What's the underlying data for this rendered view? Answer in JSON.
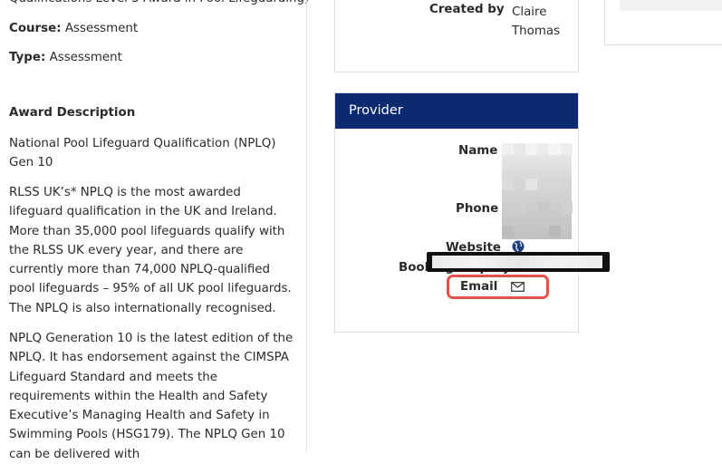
{
  "left": {
    "cut_title": "Qualifications Level 3 Award in Pool Lifeguarding)",
    "course_label": "Course:",
    "course_value": "Assessment",
    "type_label": "Type:",
    "type_value": "Assessment",
    "award_heading": "Award Description",
    "para1": "National Pool Lifeguard Qualification (NPLQ) Gen 10",
    "para2": "RLSS UK’s* NPLQ is the most awarded lifeguard qualification in the UK and Ireland. More than 35,000 pool lifeguards qualify with the RLSS UK every year, and there are currently more than 74,000 NPLQ-qualified pool lifeguards – 95% of all UK pool lifeguards. The NPLQ is also internationally recognised.",
    "para3": "NPLQ Generation 10 is the latest edition of the NPLQ. It has endorsement against the CIMSPA Lifeguard Standard and meets the requirements within the Health and Safety Executive’s Managing Health and Safety in Swimming Pools (HSG179). The NPLQ Gen 10 can be delivered with"
  },
  "top_card": {
    "created_label": "Created by",
    "created_value": "Claire Thomas"
  },
  "provider": {
    "header": "Provider",
    "name_label": "Name",
    "phone_label": "Phone",
    "website_label": "Website",
    "booking_label": "Booking Enquiry",
    "email_label": "Email",
    "icons": {
      "website": "globe-icon",
      "email": "envelope-icon"
    }
  },
  "colors": {
    "header_bg": "#0b2a6f",
    "highlight": "#e2514a"
  }
}
